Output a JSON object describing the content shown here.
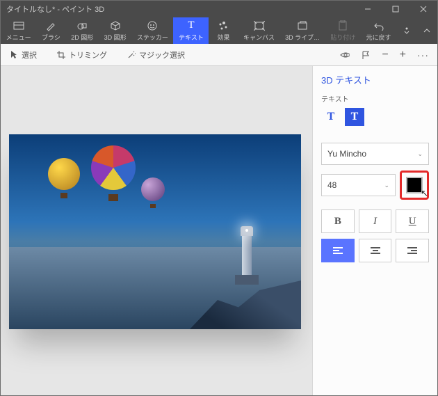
{
  "window": {
    "title": "タイトルなし* - ペイント 3D"
  },
  "ribbon": {
    "menu": "メニュー",
    "brush": "ブラシ",
    "shapes2d": "2D 図形",
    "shapes3d": "3D 図形",
    "sticker": "ステッカー",
    "text": "テキスト",
    "effects": "効果",
    "canvas": "キャンバス",
    "lib3d": "3D ライブ…",
    "paste": "貼り付け",
    "undo": "元に戻す"
  },
  "toolbar": {
    "select": "選択",
    "trimming": "トリミング",
    "magicselect": "マジック選択"
  },
  "side": {
    "title": "3D テキスト",
    "section": "テキスト",
    "font": "Yu Mincho",
    "size": "48",
    "bold": "B",
    "italic": "I",
    "underline": "U",
    "color": "#000000"
  }
}
